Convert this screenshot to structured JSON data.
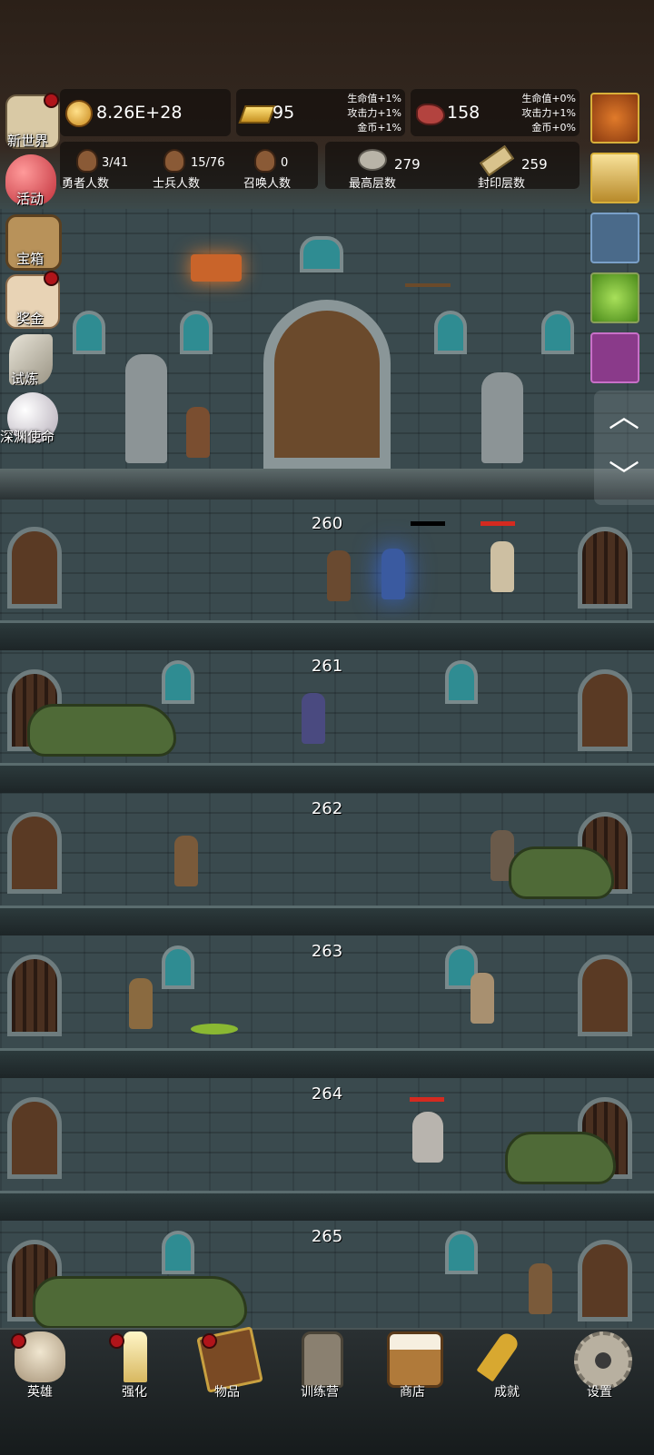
{
  "resources": {
    "coins": "8.26E+28",
    "gold": "95",
    "gold_bonus": [
      "生命值+1%",
      "攻击力+1%",
      "金币+1%"
    ],
    "meat": "158",
    "meat_bonus": [
      "生命值+0%",
      "攻击力+1%",
      "金币+0%"
    ]
  },
  "stats": {
    "heroes": {
      "value": "3/41",
      "label": "勇者人数"
    },
    "soldiers": {
      "value": "15/76",
      "label": "士兵人数"
    },
    "summons": {
      "value": "0",
      "label": "召唤人数"
    },
    "top_floor": {
      "value": "279",
      "label": "最高层数"
    },
    "sealed_floor": {
      "value": "259",
      "label": "封印层数"
    }
  },
  "left_menu": [
    {
      "label": "新世界",
      "icon": "castle-icon",
      "badge": true
    },
    {
      "label": "活动",
      "icon": "heart-icon",
      "badge": false
    },
    {
      "label": "宝箱",
      "icon": "chest-icon",
      "badge": false
    },
    {
      "label": "奖金",
      "icon": "envelope-icon",
      "badge": true
    },
    {
      "label": "试炼",
      "icon": "feather-icon",
      "badge": false
    },
    {
      "label": "深渊使命",
      "icon": "pearl-icon",
      "badge": false
    }
  ],
  "right_slots": [
    {
      "icon": "pumpkin-icon"
    },
    {
      "icon": "candle-icon"
    },
    {
      "icon": "meat-roll-icon"
    },
    {
      "icon": "slime-icon"
    },
    {
      "icon": "goblin-icon"
    }
  ],
  "floors": [
    "260",
    "261",
    "262",
    "263",
    "264",
    "265"
  ],
  "tabs": [
    {
      "label": "英雄",
      "icon": "skull-icon",
      "badge": true
    },
    {
      "label": "强化",
      "icon": "candle-icon",
      "badge": true
    },
    {
      "label": "物品",
      "icon": "book-icon",
      "badge": true
    },
    {
      "label": "训练营",
      "icon": "lantern-icon",
      "badge": false
    },
    {
      "label": "商店",
      "icon": "beer-mug-icon",
      "badge": false
    },
    {
      "label": "成就",
      "icon": "key-icon",
      "badge": false
    },
    {
      "label": "设置",
      "icon": "gear-icon",
      "badge": false
    }
  ],
  "colors": {
    "panel": "#140f0c",
    "badge": "#b0141a",
    "hp_bar": "#d42a20",
    "wall": "#3a4a4e"
  }
}
